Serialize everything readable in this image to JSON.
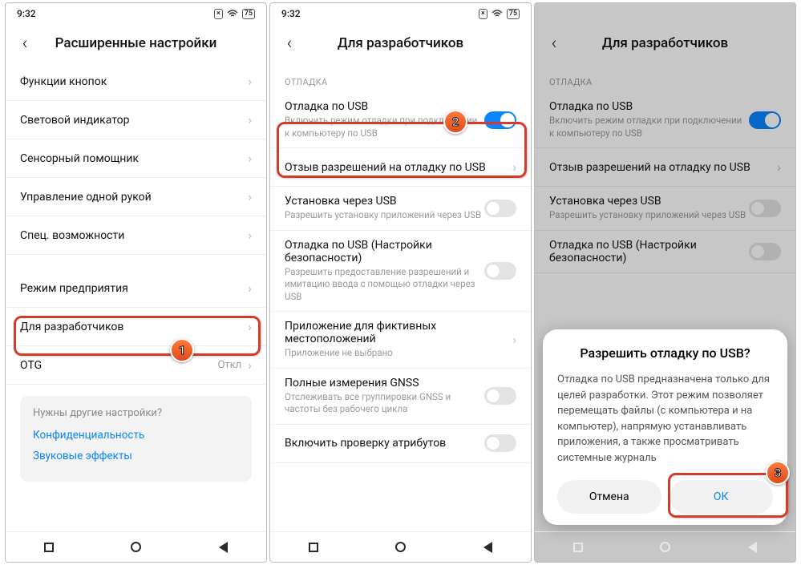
{
  "status": {
    "time": "9:32",
    "battery": "75",
    "x_icon": "×"
  },
  "screen1": {
    "title": "Расширенные настройки",
    "rows": [
      {
        "label": "Функции кнопок"
      },
      {
        "label": "Световой индикатор"
      },
      {
        "label": "Сенсорный помощник"
      },
      {
        "label": "Управление одной рукой"
      },
      {
        "label": "Спец. возможности"
      }
    ],
    "rows2": [
      {
        "label": "Режим предприятия"
      },
      {
        "label": "Для разработчиков"
      },
      {
        "label": "OTG",
        "value": "Откл"
      }
    ],
    "tip": {
      "q": "Нужны другие настройки?",
      "links": [
        "Конфиденциальность",
        "Звуковые эффекты"
      ]
    }
  },
  "screen2": {
    "title": "Для разработчиков",
    "section": "ОТЛАДКА",
    "rows": [
      {
        "label": "Отладка по USB",
        "sub": "Включить режим отладки при подключении к компьютеру по USB",
        "toggle": "on"
      },
      {
        "label": "Отзыв разрешений на отладку по USB",
        "chev": true
      },
      {
        "label": "Установка через USB",
        "sub": "Разрешить установку приложений через USB",
        "toggle": "off"
      },
      {
        "label": "Отладка по USB (Настройки безопасности)",
        "sub": "Разрешить предоставление разрешений и имитацию ввода с помощью отладки через USB",
        "toggle": "off"
      },
      {
        "label": "Приложение для фиктивных местоположений",
        "sub": "Приложение не выбрано",
        "chev": true
      },
      {
        "label": "Полные измерения GNSS",
        "sub": "Отслеживать все группировки GNSS и частоты без рабочего цикла",
        "toggle": "off"
      },
      {
        "label": "Включить проверку атрибутов",
        "toggle": "off"
      }
    ]
  },
  "screen3": {
    "title": "Для разработчиков",
    "section": "ОТЛАДКА",
    "rows": [
      {
        "label": "Отладка по USB",
        "sub": "Включить режим отладки при подключении к компьютеру по USB",
        "toggle": "on"
      },
      {
        "label": "Отзыв разрешений на отладку по USB",
        "chev": true
      },
      {
        "label": "Установка через USB",
        "sub": "Разрешить установку приложений через USB",
        "toggle": "off"
      },
      {
        "label": "Отладка по USB (Настройки безопасности)",
        "sub": "",
        "toggle": "off"
      }
    ],
    "dialog": {
      "title": "Разрешить отладку по USB?",
      "body": "Отладка по USB предназначена только для целей разработки. Этот режим позволяет перемещать файлы (с компьютера и на компьютер), напрямую устанавливать приложения, а также просматривать системные журналь",
      "cancel": "Отмена",
      "ok": "ОК"
    }
  },
  "badges": {
    "b1": "1",
    "b2": "2",
    "b3": "3"
  }
}
